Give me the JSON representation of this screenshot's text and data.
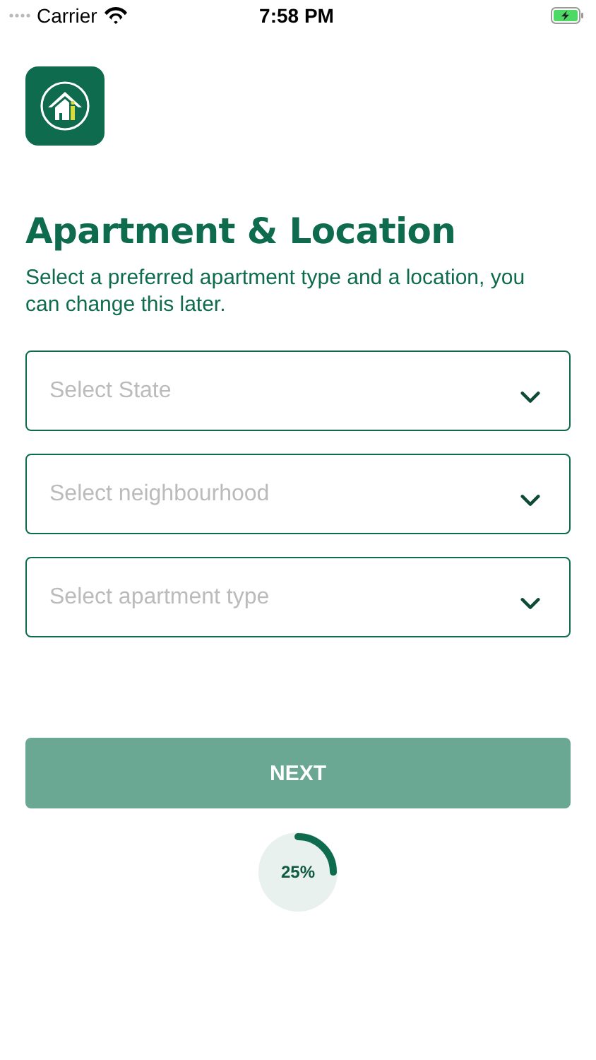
{
  "status_bar": {
    "carrier": "Carrier",
    "time": "7:58 PM"
  },
  "title": "Apartment & Location",
  "subtitle": "Select a preferred apartment type and a location, you can change this later.",
  "selects": [
    {
      "placeholder": "Select State"
    },
    {
      "placeholder": "Select neighbourhood"
    },
    {
      "placeholder": "Select apartment type"
    }
  ],
  "next_button": {
    "label": "NEXT",
    "disabled": true
  },
  "progress": {
    "reading": "25%"
  }
}
